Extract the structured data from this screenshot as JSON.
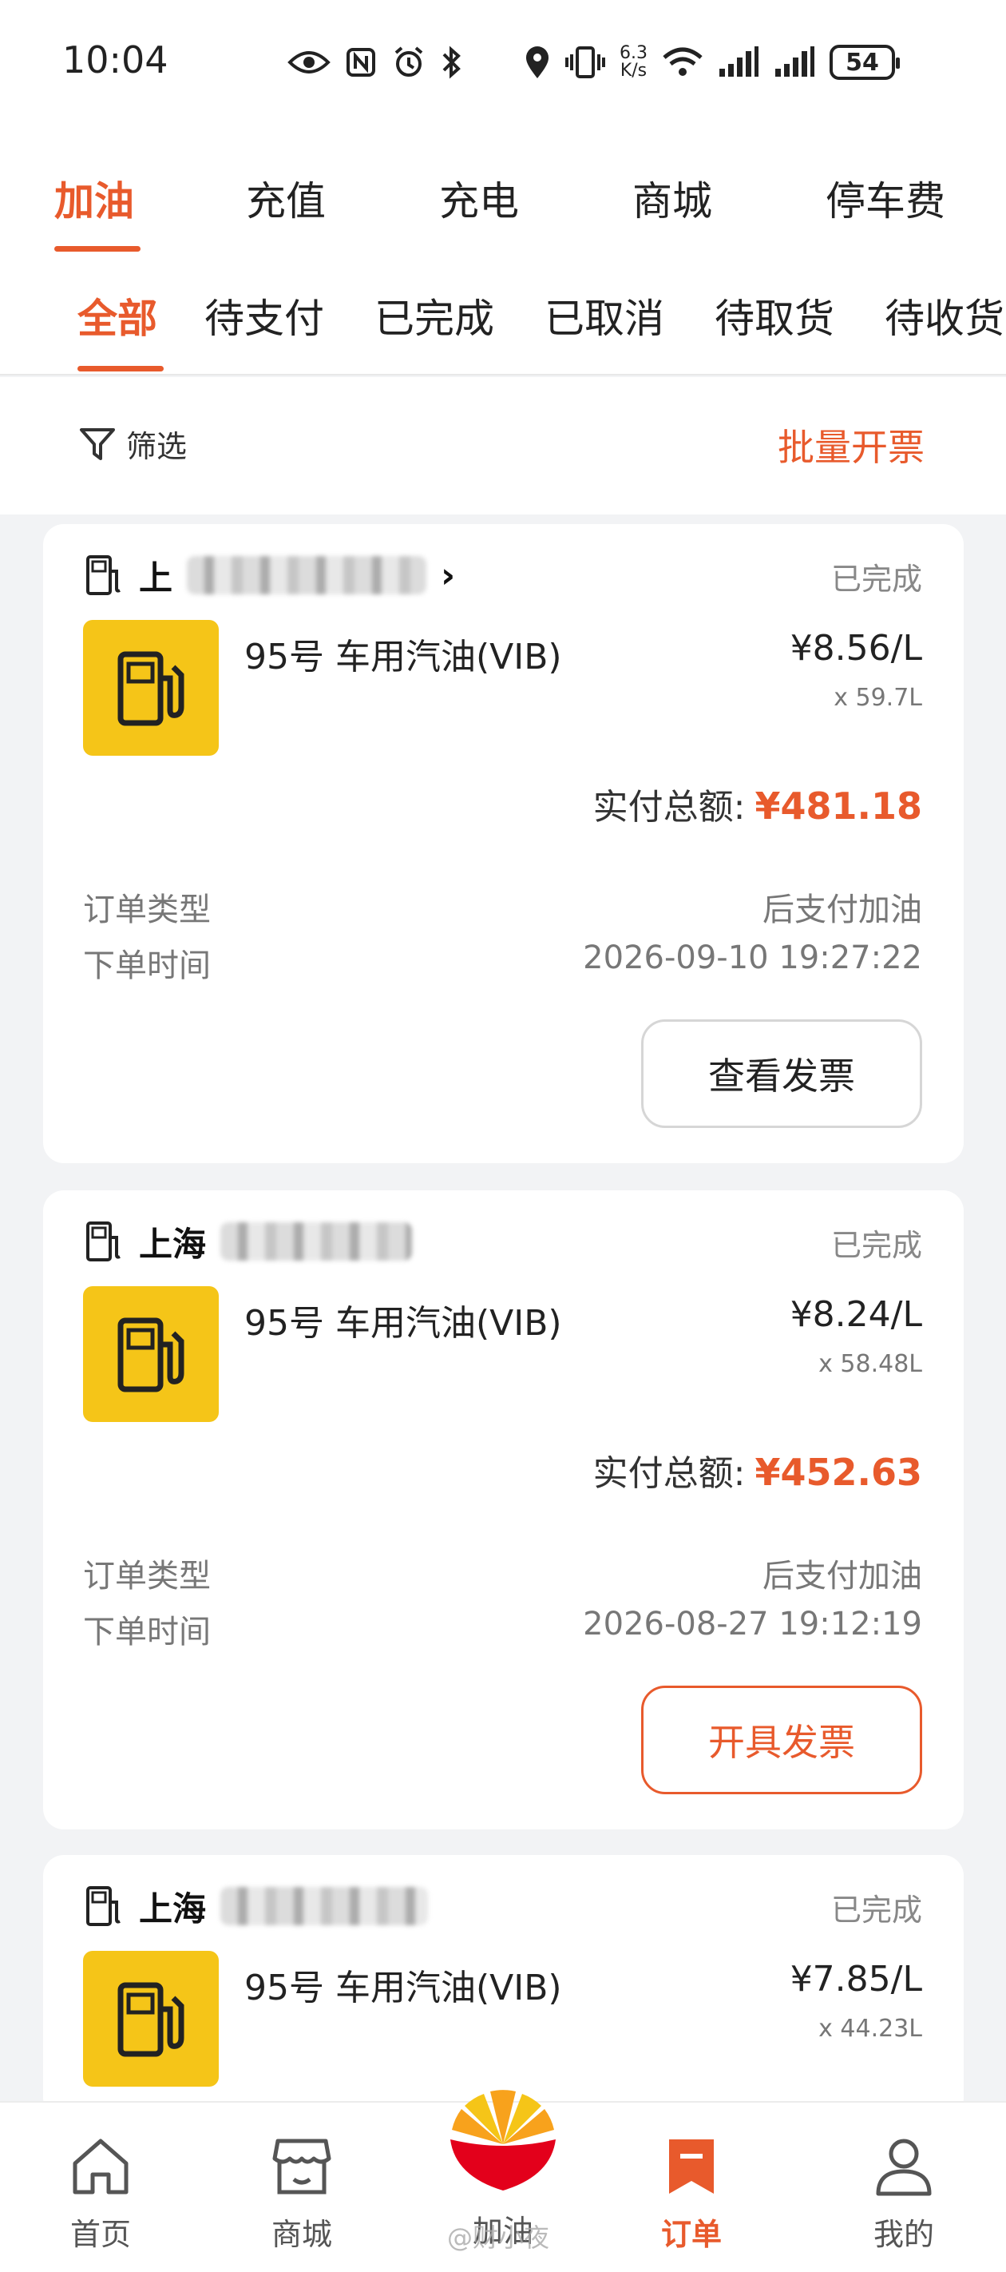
{
  "status_bar": {
    "time": "10:04",
    "net_speed_value": "6.3",
    "net_speed_unit": "K/s",
    "battery": "54"
  },
  "top_tabs": [
    "加油",
    "充值",
    "充电",
    "商城",
    "停车费"
  ],
  "sub_tabs": [
    "全部",
    "待支付",
    "已完成",
    "已取消",
    "待取货",
    "待收货"
  ],
  "filter": {
    "label": "筛选",
    "batch_invoice": "批量开票"
  },
  "orders": [
    {
      "station_name": "上",
      "status": "已完成",
      "product": "95号 车用汽油(VIB)",
      "unit_price": "¥8.56/L",
      "quantity": "x 59.7L",
      "total_label": "实付总额:",
      "total_amount": "¥481.18",
      "order_type_label": "订单类型",
      "order_type": "后支付加油",
      "order_time_label": "下单时间",
      "order_time": "2026-09-10 19:27:22",
      "invoice_button": "查看发票"
    },
    {
      "station_name": "上海",
      "status": "已完成",
      "product": "95号 车用汽油(VIB)",
      "unit_price": "¥8.24/L",
      "quantity": "x 58.48L",
      "total_label": "实付总额:",
      "total_amount": "¥452.63",
      "order_type_label": "订单类型",
      "order_type": "后支付加油",
      "order_time_label": "下单时间",
      "order_time": "2026-08-27 19:12:19",
      "invoice_button": "开具发票"
    },
    {
      "station_name": "上海",
      "status": "已完成",
      "product": "95号 车用汽油(VIB)",
      "unit_price": "¥7.85/L",
      "quantity": "x 44.23L"
    }
  ],
  "bottom_nav": [
    "首页",
    "商城",
    "加油",
    "订单",
    "我的"
  ],
  "watermark": "@财小夜",
  "colors": {
    "accent": "#e85a2c",
    "fuel_thumb": "#f5c518",
    "background": "#f2f3f5"
  },
  "icons": [
    "eye-icon",
    "nfc-icon",
    "alarm-icon",
    "bluetooth-icon",
    "location-icon",
    "vibrate-icon",
    "wifi-icon",
    "signal-icon",
    "battery-icon",
    "filter-icon",
    "gas-station-icon",
    "fuel-pump-icon",
    "home-icon",
    "shop-icon",
    "petrochina-logo-icon",
    "bookmark-icon",
    "user-icon"
  ]
}
